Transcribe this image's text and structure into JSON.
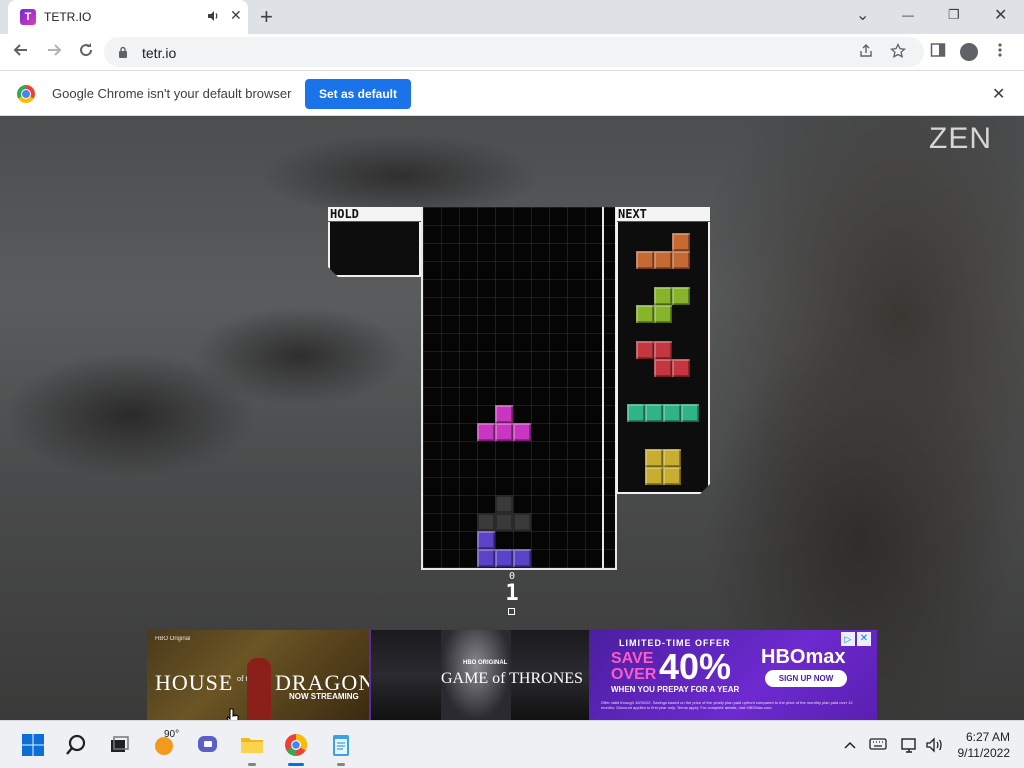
{
  "browser": {
    "tab": {
      "title": "TETR.IO",
      "favicon": "T",
      "audio_icon": "speaker-icon",
      "close": "✕"
    },
    "new_tab": "+",
    "window_controls": {
      "tabs_menu": "⌄",
      "minimize": "—",
      "restore": "❐",
      "close": "✕"
    },
    "url": "tetr.io",
    "infobar": {
      "message": "Google Chrome isn't your default browser",
      "button": "Set as default",
      "close": "✕"
    }
  },
  "game": {
    "mode_label": "ZEN",
    "hold_label": "HOLD",
    "next_label": "NEXT",
    "counter_small": "0",
    "counter_big": "1",
    "colors": {
      "T": "#c936c0",
      "J": "#5a43c4",
      "L": "#c66a33",
      "S": "#86b52b",
      "Z": "#c5373f",
      "I": "#2fb387",
      "O": "#c7ad30",
      "ghost": "#3a3a3a"
    }
  },
  "ad": {
    "hotd": {
      "brand": "HBO Original",
      "title_top": "HOUSE",
      "title_of": "of the",
      "title_bottom": "DRAGON",
      "sub": "NOW STREAMING"
    },
    "got": {
      "brand": "HBO ORIGINAL",
      "title": "GAME of THRONES"
    },
    "hbo": {
      "offer": "LIMITED-TIME OFFER",
      "save": "SAVE",
      "over": "OVER",
      "percent": "40%",
      "prepay": "WHEN YOU PREPAY FOR A YEAR",
      "brand": "HBOmax",
      "cta": "SIGN UP NOW",
      "fine_print": "Offer valid through 10/30/22. Savings based on the price of the yearly plan paid upfront compared to the price of the monthly plan paid over 12 months. Discount applies to first year only. Terms apply. For complete details, visit HBOMax.com."
    }
  },
  "taskbar": {
    "weather": "90°",
    "time": "6:27 AM",
    "date": "9/11/2022"
  }
}
